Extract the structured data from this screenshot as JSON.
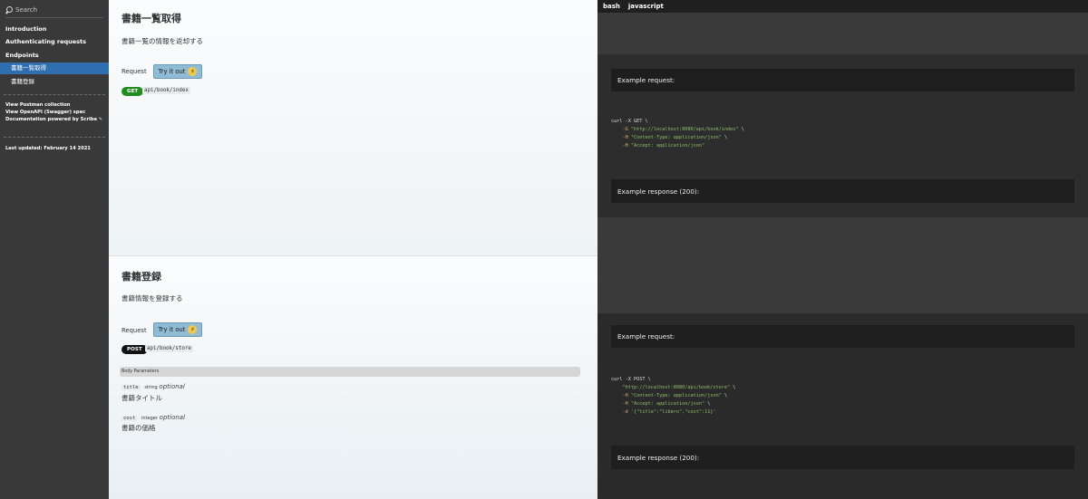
{
  "sidebar": {
    "search_placeholder": "Search",
    "nav": {
      "introduction": "Introduction",
      "authenticating": "Authenticating requests",
      "endpoints": "Endpoints",
      "books_list": "書籍一覧取得",
      "book_register": "書籍登録"
    },
    "links": {
      "postman": "View Postman collection",
      "openapi": "View OpenAPI (Swagger) spec",
      "powered": "Documentation powered by Scribe",
      "powered_icon": "✎"
    },
    "last_updated": "Last updated: February 14 2021"
  },
  "main": {
    "sections": [
      {
        "title": "書籍一覧取得",
        "description": "書籍一覧の情報を返却する",
        "request_label": "Request",
        "try_label": "Try it out",
        "method": "GET",
        "endpoint": "api/book/index"
      },
      {
        "title": "書籍登録",
        "description": "書籍情報を登録する",
        "request_label": "Request",
        "try_label": "Try it out",
        "method": "POST",
        "endpoint": "api/book/store",
        "body_params_label": "Body Parameters",
        "params": [
          {
            "name": "title",
            "type": "string",
            "optional": "optional",
            "description": "書籍タイトル"
          },
          {
            "name": "cost",
            "type": "integer",
            "optional": "optional",
            "description": "書籍の価格"
          }
        ]
      }
    ]
  },
  "code": {
    "tabs": [
      "bash",
      "javascript"
    ],
    "blocks": [
      {
        "example_request": "Example request:",
        "lines": {
          "l1": "curl -X GET \\",
          "l2_flag": "    -G ",
          "l2_str": "\"http://localhost:8080/api/book/index\"",
          "l2_end": " \\",
          "l3_flag": "    -H ",
          "l3_str": "\"Content-Type: application/json\"",
          "l3_end": " \\",
          "l4_flag": "    -H ",
          "l4_str": "\"Accept: application/json\""
        },
        "example_response": "Example response (200):"
      },
      {
        "example_request": "Example request:",
        "lines": {
          "l1": "curl -X POST \\",
          "l2_str": "    \"http://localhost:8080/api/book/store\"",
          "l2_end": " \\",
          "l3_flag": "    -H ",
          "l3_str": "\"Content-Type: application/json\"",
          "l3_end": " \\",
          "l4_flag": "    -H ",
          "l4_str": "\"Accept: application/json\"",
          "l4_end": " \\",
          "l5_flag": "    -d ",
          "l5_str": "'{\"title\":\"libero\",\"cost\":11}'"
        },
        "example_response": "Example response (200):"
      }
    ]
  }
}
